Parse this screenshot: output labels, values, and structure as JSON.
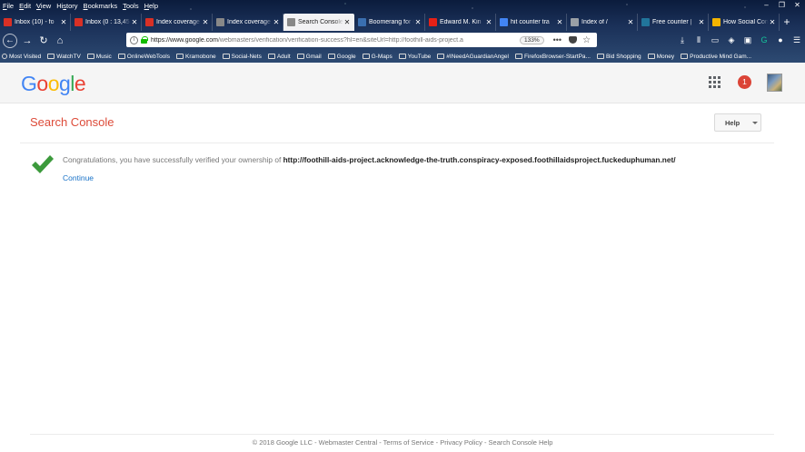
{
  "menubar": {
    "items": [
      "File",
      "Edit",
      "View",
      "History",
      "Bookmarks",
      "Tools",
      "Help"
    ],
    "underline_index": [
      0,
      0,
      0,
      2,
      0,
      0,
      0
    ]
  },
  "window": {
    "minimize": "–",
    "restore": "❐",
    "close": "✕"
  },
  "tabs": [
    {
      "title": "Inbox (10) - fo",
      "favicon": "gmail-icon",
      "color": "#d93025"
    },
    {
      "title": "Inbox (0 : 13,45",
      "favicon": "gmail-icon",
      "color": "#d93025"
    },
    {
      "title": "Index coverage",
      "favicon": "gmail-icon",
      "color": "#d93025"
    },
    {
      "title": "Index coverage",
      "favicon": "search-console-icon",
      "color": "#888888"
    },
    {
      "title": "Search Console",
      "favicon": "search-console-icon",
      "color": "#888888",
      "active": true
    },
    {
      "title": "Boomerang for Gm",
      "favicon": "boomerang-icon",
      "color": "#3a6fb0"
    },
    {
      "title": "Edward M. Kin",
      "favicon": "youtube-icon",
      "color": "#e62117"
    },
    {
      "title": "hit counter tra",
      "favicon": "google-icon",
      "color": "#4285f4"
    },
    {
      "title": "Index of /",
      "favicon": "page-icon",
      "color": "#9aa0a6"
    },
    {
      "title": "Free counter |",
      "favicon": "wordpress-icon",
      "color": "#21759b"
    },
    {
      "title": "How Social Con",
      "favicon": "doc-icon",
      "color": "#f4b400"
    }
  ],
  "newtab": "+",
  "url": {
    "host": "https://www.google.com",
    "path": "/webmasters/verification/verification-success?hl=en&siteUrl=http://foothill-aids-project.a",
    "zoom": "133%",
    "more": "•••"
  },
  "bookmarks": [
    {
      "label": "Most Visited",
      "icon": "gear-icon"
    },
    {
      "label": "WatchTV",
      "icon": "folder-icon"
    },
    {
      "label": "Music",
      "icon": "folder-icon"
    },
    {
      "label": "OnlineWebTools",
      "icon": "folder-icon"
    },
    {
      "label": "Kramobone",
      "icon": "folder-icon"
    },
    {
      "label": "Social-Nets",
      "icon": "folder-icon"
    },
    {
      "label": "Adult",
      "icon": "folder-icon"
    },
    {
      "label": "Gmail",
      "icon": "gmail-icon"
    },
    {
      "label": "Google",
      "icon": "google-icon"
    },
    {
      "label": "G-Maps",
      "icon": "maps-icon"
    },
    {
      "label": "YouTube",
      "icon": "folder-icon"
    },
    {
      "label": "#INeedAGuardianAngel",
      "icon": "folder-icon"
    },
    {
      "label": "FirefoxBrowser-StartPa...",
      "icon": "folder-icon"
    },
    {
      "label": "Bid Shopping",
      "icon": "folder-icon"
    },
    {
      "label": "Money",
      "icon": "folder-icon"
    },
    {
      "label": "Productive Mind Gam...",
      "icon": "bookmark-icon"
    }
  ],
  "header": {
    "logo_letters": [
      "G",
      "o",
      "o",
      "g",
      "l",
      "e"
    ],
    "notifications": "1"
  },
  "main": {
    "title": "Search Console",
    "help_label": "Help",
    "message_prefix": "Congratulations, you have successfully verified your ownership of",
    "verified_url": "http://foothill-aids-project.acknowledge-the-truth.conspiracy-exposed.foothillaidsproject.fuckeduphuman.net/",
    "continue_label": "Continue"
  },
  "footer": {
    "links": [
      "© 2018 Google LLC",
      "Webmaster Central",
      "Terms of Service",
      "Privacy Policy",
      "Search Console Help"
    ],
    "separator": " - "
  },
  "colors": {
    "accent_red": "#dd4b39",
    "success_green": "#3c9a3c",
    "link_blue": "#1a73c8"
  }
}
